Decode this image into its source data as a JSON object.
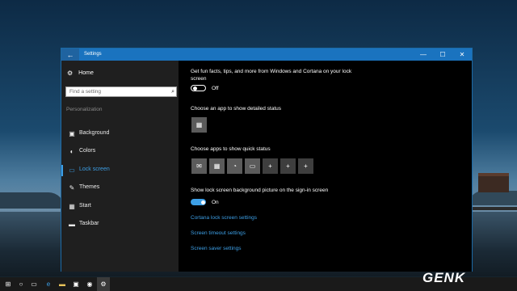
{
  "window": {
    "title": "Settings"
  },
  "titlebar": {
    "back_icon": "back-arrow-icon",
    "minimize": "—",
    "maximize": "☐",
    "close": "✕"
  },
  "sidebar": {
    "home_label": "Home",
    "search_placeholder": "Find a setting",
    "section": "Personalization",
    "items": [
      {
        "label": "Background",
        "icon": "picture-icon",
        "glyph": "▣",
        "active": false
      },
      {
        "label": "Colors",
        "icon": "palette-icon",
        "glyph": "◐",
        "active": false
      },
      {
        "label": "Lock screen",
        "icon": "lock-screen-icon",
        "glyph": "▭",
        "active": true
      },
      {
        "label": "Themes",
        "icon": "brush-icon",
        "glyph": "✎",
        "active": false
      },
      {
        "label": "Start",
        "icon": "start-icon",
        "glyph": "▦",
        "active": false
      },
      {
        "label": "Taskbar",
        "icon": "taskbar-icon",
        "glyph": "▬",
        "active": false
      }
    ]
  },
  "content": {
    "fun_facts": {
      "text": "Get fun facts, tips, and more from Windows and Cortana on your lock screen",
      "state": "Off"
    },
    "detailed_status": {
      "label": "Choose an app to show detailed status"
    },
    "quick_status": {
      "label": "Choose apps to show quick status"
    },
    "bg_signin": {
      "label": "Show lock screen background picture on the sign-in screen",
      "state": "On"
    },
    "links": [
      "Cortana lock screen settings",
      "Screen timeout settings",
      "Screen saver settings"
    ],
    "accent_color": "#3d9fe6"
  },
  "taskbar": {
    "icons": [
      "windows-logo-icon",
      "search-icon",
      "task-view-icon",
      "edge-icon",
      "file-explorer-icon",
      "store-icon",
      "media-icon",
      "settings-icon"
    ]
  },
  "watermark": "GENK"
}
